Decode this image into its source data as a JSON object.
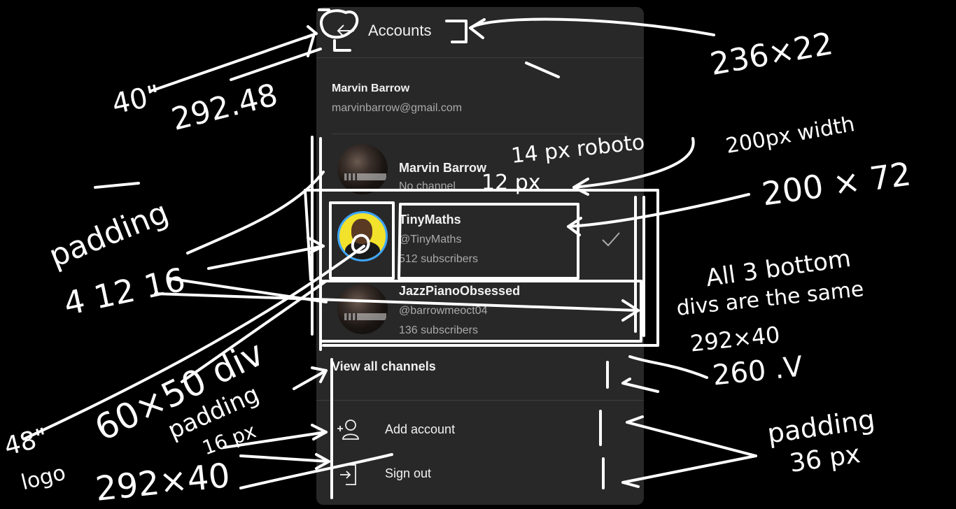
{
  "header": {
    "title": "Accounts"
  },
  "user": {
    "name": "Marvin Barrow",
    "email": "marvinbarrow@gmail.com"
  },
  "channels": [
    {
      "name": "Marvin Barrow",
      "line1": "No channel",
      "line2": "",
      "avatar": "piano-avatar",
      "selected": false
    },
    {
      "name": "TinyMaths",
      "line1": "@TinyMaths",
      "line2": "512 subscribers",
      "avatar": "tinymaths-avatar",
      "selected": true
    },
    {
      "name": "JazzPianoObsessed",
      "line1": "@barrowmeoct04",
      "line2": "136 subscribers",
      "avatar": "piano-avatar",
      "selected": false
    }
  ],
  "view_all": "View all channels",
  "menu": [
    {
      "label": "Add account",
      "icon": "add-person-icon"
    },
    {
      "label": "Sign out",
      "icon": "sign-out-icon"
    }
  ],
  "annotations": {
    "a1": "40\"",
    "a2": "292.48",
    "a3": "236×22",
    "a4": "14 px roboto",
    "a5": "200px width",
    "a6": "200 × 72",
    "a7": "12 px",
    "a8": "padding",
    "a9": "4 12 16",
    "a10": "All 3 bottom",
    "a11": "divs are the same",
    "a12": "292×40",
    "a13": "260 .V",
    "a14": "60×50 div",
    "a15": "48\"",
    "a16": "logo",
    "a17": "padding",
    "a18": "16 px",
    "a19": "292×40",
    "a20": "padding",
    "a21": "36 px"
  },
  "colors": {
    "background": "#000000",
    "panel": "#282828",
    "text": "#f1f1f1",
    "muted": "#aaaaaa",
    "accent": "#3ea6ff",
    "ink": "#ffffff"
  }
}
